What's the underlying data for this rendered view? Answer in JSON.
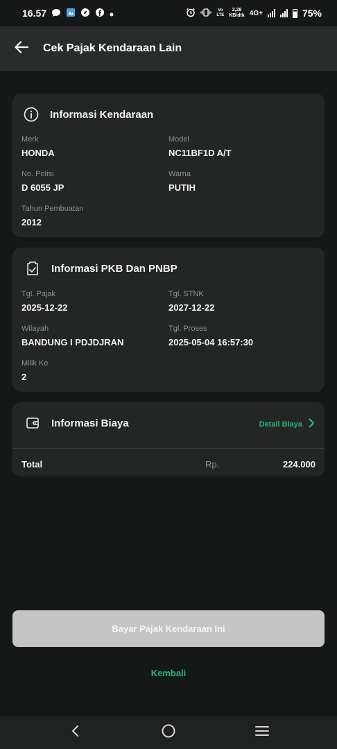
{
  "status_bar": {
    "time": "16.57",
    "net_speed_value": "2,28",
    "net_speed_unit": "KB/dtk",
    "volte_top": "Vo",
    "volte_bottom": "LTE",
    "network": "4G+",
    "battery": "75%"
  },
  "app_bar": {
    "title": "Cek Pajak Kendaraan Lain"
  },
  "vehicle_info": {
    "title": "Informasi Kendaraan",
    "merk_label": "Merk",
    "merk_value": "HONDA",
    "model_label": "Model",
    "model_value": "NC11BF1D A/T",
    "nopol_label": "No. Polisi",
    "nopol_value": "D 6055 JP",
    "warna_label": "Warna",
    "warna_value": "PUTIH",
    "tahun_label": "Tahun Pembuatan",
    "tahun_value": "2012"
  },
  "pkb_info": {
    "title": "Informasi PKB Dan PNBP",
    "tgl_pajak_label": "Tgl. Pajak",
    "tgl_pajak_value": "2025-12-22",
    "tgl_stnk_label": "Tgl. STNK",
    "tgl_stnk_value": "2027-12-22",
    "wilayah_label": "Wilayah",
    "wilayah_value": "BANDUNG I PDJDJRAN",
    "tgl_proses_label": "Tgl. Proses",
    "tgl_proses_value": "2025-05-04 16:57:30",
    "milik_label": "Milik Ke",
    "milik_value": "2"
  },
  "cost_info": {
    "title": "Informasi Biaya",
    "detail_link": "Detail Biaya",
    "total_label": "Total",
    "currency": "Rp.",
    "total_amount": "224.000"
  },
  "actions": {
    "pay_button": "Bayar Pajak Kendaraan Ini",
    "back_link": "Kembali"
  },
  "colors": {
    "accent_green": "#1db974",
    "background": "#161717",
    "card": "#242626",
    "disabled_button": "#c5c5c5"
  },
  "icons": {
    "back": "arrow-left-icon",
    "info": "info-circle-icon",
    "document": "document-check-icon",
    "wallet": "wallet-icon",
    "chevron": "chevron-right-icon"
  }
}
